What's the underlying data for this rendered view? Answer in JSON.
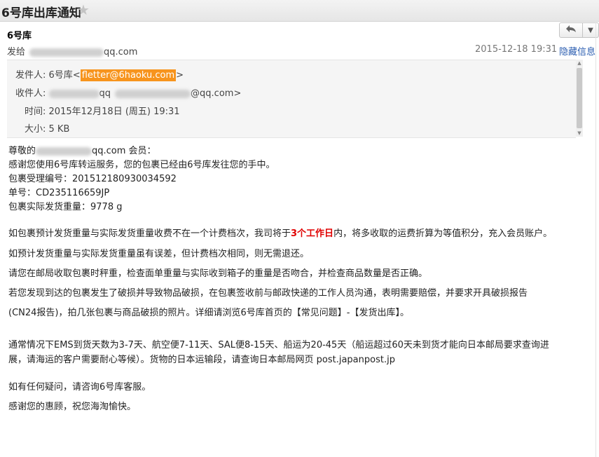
{
  "window": {
    "title": "6号库出库通知",
    "star_icon": "star-icon"
  },
  "header": {
    "sender_name": "6号库",
    "to_label": "发给",
    "to_suffix": "qq.com",
    "date": "2015-12-18 19:31",
    "hide_label": "隐藏信息",
    "reply_icon": "reply-icon",
    "more_icon": "chevron-down-icon"
  },
  "details": {
    "from_label": "发件人:",
    "from_name": "6号库",
    "from_email": "fletter@6haoku.com",
    "to_label": "收件人:",
    "to_partial": "qq",
    "to_suffix": "@qq.com>",
    "time_label": "时间:",
    "time_value": "2015年12月18日 (周五) 19:31",
    "size_label": "大小:",
    "size_value": "5 KB"
  },
  "body": {
    "greet_prefix": "尊敬的",
    "greet_suffix": "qq.com 会员：",
    "line2": "感谢您使用6号库转运服务，您的包裹已经由6号库发往您的手中。",
    "line3": "包裹受理编号：201512180930034592",
    "line4": "单号：CD235116659JP",
    "line5": "包裹实际发货重量：9778 g",
    "p1_a": "如包裹预计发货重量与实际发货重量收费不在一个计费档次，我司将于",
    "p1_red": "3个工作日",
    "p1_b": "内，将多收取的运费折算为等值积分，充入会员账户。",
    "p2": "如预计发货重量与实际发货重量虽有误差，但计费档次相同，则无需退还。",
    "p3": "请您在邮局收取包裹时秤重，检查面单重量与实际收到箱子的重量是否吻合，并检查商品数量是否正确。",
    "p4a": "若您发现到达的包裹发生了破损并导致物品破损，在包裹签收前与邮政快递的工作人员沟通，表明需要赔偿，并要求开具破损报告",
    "p4b": "(CN24报告)，拍几张包裹与商品破损的照片。详细请浏览6号库首页的【常见问题】-【发货出库】。",
    "p5a": "通常情况下EMS到货天数为3-7天、航空便7-11天、SAL便8-15天、船运为20-45天（船运超过60天未到货才能向日本邮局要求查询进",
    "p5b": "展，请海运的客户需要耐心等候）。货物的日本运输段，请查询日本邮局网页 post.japanpost.jp",
    "p6": "如有任何疑问，请咨询6号库客服。",
    "p7": "感谢您的惠顾，祝您海淘愉快。"
  }
}
